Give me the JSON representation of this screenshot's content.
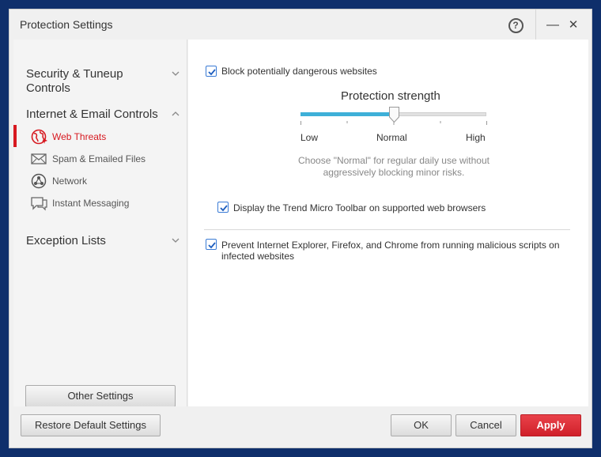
{
  "window": {
    "title": "Protection Settings",
    "help_label": "?",
    "minimize_label": "—",
    "close_label": "✕"
  },
  "sidebar": {
    "sections": [
      {
        "label": "Security & Tuneup Controls",
        "expanded": false
      },
      {
        "label": "Internet & Email Controls",
        "expanded": true
      },
      {
        "label": "Exception Lists",
        "expanded": false
      }
    ],
    "items": [
      {
        "label": "Web Threats",
        "icon": "globe-icon",
        "active": true
      },
      {
        "label": "Spam & Emailed Files",
        "icon": "mail-icon",
        "active": false
      },
      {
        "label": "Network",
        "icon": "network-icon",
        "active": false
      },
      {
        "label": "Instant Messaging",
        "icon": "chat-icon",
        "active": false
      }
    ],
    "other_settings_label": "Other Settings"
  },
  "content": {
    "block_sites": {
      "label": "Block potentially dangerous websites",
      "checked": true
    },
    "protection": {
      "title": "Protection strength",
      "levels": [
        "Low",
        "Normal",
        "High"
      ],
      "selected": "Normal",
      "hint": "Choose \"Normal\" for regular daily use without aggressively blocking minor risks."
    },
    "toolbar": {
      "label": "Display the Trend Micro Toolbar on supported web browsers",
      "checked": true
    },
    "scripts": {
      "label": "Prevent Internet Explorer, Firefox, and Chrome from running malicious scripts on infected websites",
      "checked": true
    }
  },
  "footer": {
    "restore_label": "Restore Default Settings",
    "ok_label": "OK",
    "cancel_label": "Cancel",
    "apply_label": "Apply"
  },
  "colors": {
    "accent_red": "#d71920",
    "slider_blue": "#3eb0d8",
    "checkbox_blue": "#3a7bd5"
  }
}
